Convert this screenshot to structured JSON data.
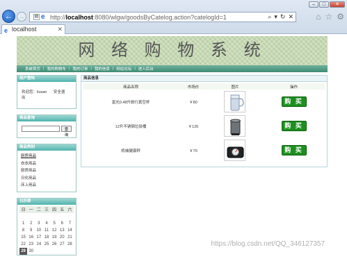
{
  "browser": {
    "url_prefix": "http://",
    "url_host": "localhost",
    "url_rest": ":8080/wlgw/goodsByCatelog.action?catelogId=1",
    "tab_title": "localhost",
    "colors": {
      "accent": "#1a5fbf"
    }
  },
  "site": {
    "title": "网 络 购 物 系 统",
    "nav": [
      "系统首页",
      "我的购物车",
      "我的订单",
      "我的信息",
      "网站论坛",
      "进入后台"
    ]
  },
  "left": {
    "login_head": "用户登陆",
    "welcome": "欢迎您：liusan",
    "logout": "安全退出",
    "search_head": "商品查询",
    "search_value": "",
    "search_button": "查询",
    "cats_head": "商品类别",
    "categories": [
      "厨房用品",
      "衣衣用品",
      "厨房用品",
      "日化用品",
      "床上用品"
    ],
    "cal_head": "日历表",
    "weekdays": [
      "日",
      "一",
      "二",
      "三",
      "四",
      "五",
      "六"
    ],
    "weeks": [
      [
        "",
        "",
        "",
        "",
        "",
        "",
        ""
      ],
      [
        "1",
        "2",
        "3",
        "4",
        "5",
        "6",
        "7"
      ],
      [
        "8",
        "9",
        "10",
        "11",
        "12",
        "13",
        "14"
      ],
      [
        "15",
        "16",
        "17",
        "18",
        "19",
        "20",
        "21"
      ],
      [
        "22",
        "23",
        "24",
        "25",
        "26",
        "27",
        "28"
      ],
      [
        "29",
        "30",
        "",
        "",
        "",
        "",
        ""
      ]
    ],
    "today": "29"
  },
  "main": {
    "head": "商品信息",
    "columns": [
      "商品名称",
      "市场价",
      "图片",
      "操作"
    ],
    "rows": [
      {
        "name": "富光0.48升旅行真空杯",
        "price": "￥80",
        "img": "cup-image",
        "action": "购 买"
      },
      {
        "name": "12升不锈钢垃圾桶",
        "price": "￥120",
        "img": "trash-can-image",
        "action": "购 买"
      },
      {
        "name": "机械健康秤",
        "price": "￥70",
        "img": "scale-image",
        "action": "购 买"
      }
    ]
  },
  "watermark": "https://blog.csdn.net/QQ_346127357"
}
